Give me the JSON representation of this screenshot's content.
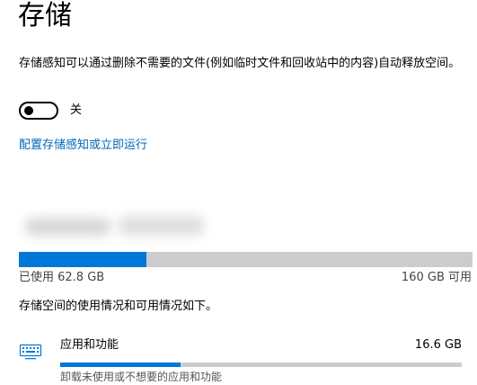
{
  "header": {
    "title": "存储"
  },
  "storage_sense": {
    "description": "存储感知可以通过删除不需要的文件(例如临时文件和回收站中的内容)自动释放空间。",
    "toggle_state_label": "关",
    "toggle_on": false,
    "config_link": "配置存储感知或立即运行"
  },
  "drive": {
    "used_label": "已使用 62.8 GB",
    "free_label": "160 GB 可用",
    "used_fraction": 0.282
  },
  "usage": {
    "section_description": "存储空间的使用情况和可用情况如下。",
    "categories": [
      {
        "icon": "apps-keyboard-icon",
        "name": "应用和功能",
        "size": "16.6 GB",
        "fraction": 0.3,
        "subtitle": "卸载未使用或不想要的应用和功能"
      }
    ]
  },
  "colors": {
    "accent": "#0078d7",
    "link": "#0067b8",
    "track": "#cccccc"
  }
}
